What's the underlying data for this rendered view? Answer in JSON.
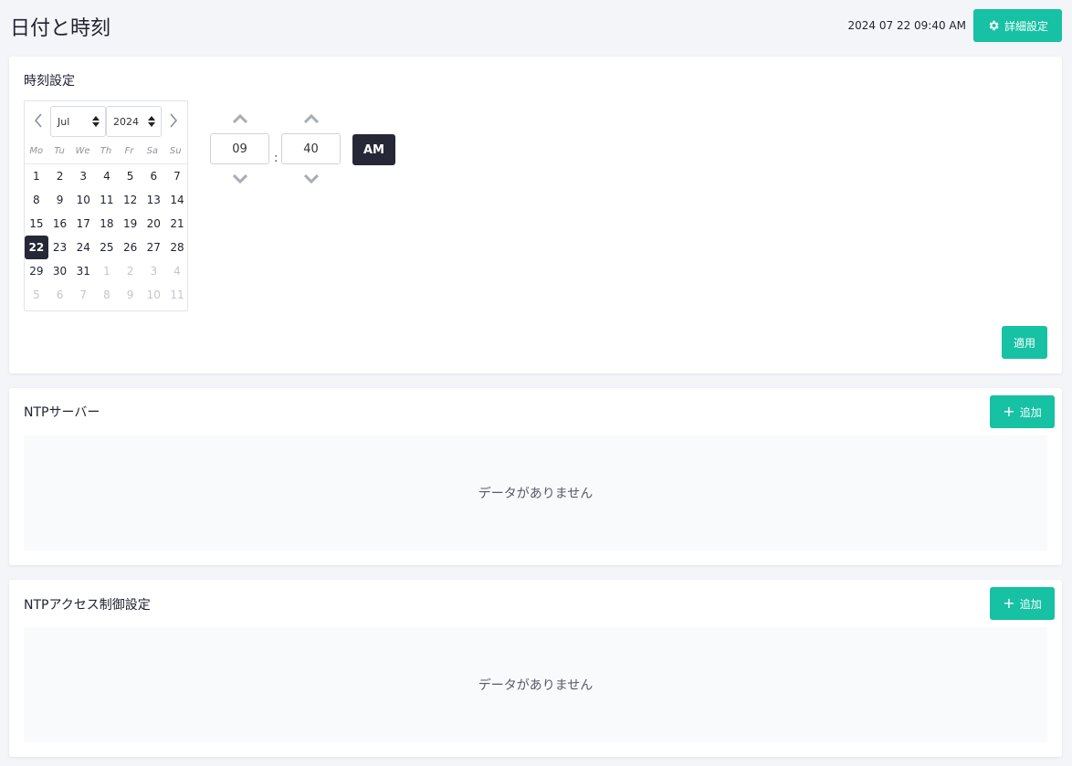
{
  "header": {
    "title": "日付と時刻",
    "datetime": "2024 07 22 09:40 AM",
    "settings_label": "詳細設定"
  },
  "time_settings": {
    "title": "時刻設定",
    "calendar": {
      "month": "Jul",
      "year": "2024",
      "weekdays": [
        "Mo",
        "Tu",
        "We",
        "Th",
        "Fr",
        "Sa",
        "Su"
      ],
      "days": [
        {
          "d": "1",
          "muted": false
        },
        {
          "d": "2",
          "muted": false
        },
        {
          "d": "3",
          "muted": false
        },
        {
          "d": "4",
          "muted": false
        },
        {
          "d": "5",
          "muted": false
        },
        {
          "d": "6",
          "muted": false
        },
        {
          "d": "7",
          "muted": false
        },
        {
          "d": "8",
          "muted": false
        },
        {
          "d": "9",
          "muted": false
        },
        {
          "d": "10",
          "muted": false
        },
        {
          "d": "11",
          "muted": false
        },
        {
          "d": "12",
          "muted": false
        },
        {
          "d": "13",
          "muted": false
        },
        {
          "d": "14",
          "muted": false
        },
        {
          "d": "15",
          "muted": false
        },
        {
          "d": "16",
          "muted": false
        },
        {
          "d": "17",
          "muted": false
        },
        {
          "d": "18",
          "muted": false
        },
        {
          "d": "19",
          "muted": false
        },
        {
          "d": "20",
          "muted": false
        },
        {
          "d": "21",
          "muted": false
        },
        {
          "d": "22",
          "muted": false,
          "selected": true
        },
        {
          "d": "23",
          "muted": false
        },
        {
          "d": "24",
          "muted": false
        },
        {
          "d": "25",
          "muted": false
        },
        {
          "d": "26",
          "muted": false
        },
        {
          "d": "27",
          "muted": false
        },
        {
          "d": "28",
          "muted": false
        },
        {
          "d": "29",
          "muted": false
        },
        {
          "d": "30",
          "muted": false
        },
        {
          "d": "31",
          "muted": false
        },
        {
          "d": "1",
          "muted": true
        },
        {
          "d": "2",
          "muted": true
        },
        {
          "d": "3",
          "muted": true
        },
        {
          "d": "4",
          "muted": true
        },
        {
          "d": "5",
          "muted": true
        },
        {
          "d": "6",
          "muted": true
        },
        {
          "d": "7",
          "muted": true
        },
        {
          "d": "8",
          "muted": true
        },
        {
          "d": "9",
          "muted": true
        },
        {
          "d": "10",
          "muted": true
        },
        {
          "d": "11",
          "muted": true
        }
      ]
    },
    "hour": "09",
    "minute": "40",
    "colon": ":",
    "meridiem": "AM",
    "apply_label": "適用"
  },
  "ntp_servers": {
    "title": "NTPサーバー",
    "add_label": "追加",
    "empty_text": "データがありません"
  },
  "ntp_access": {
    "title": "NTPアクセス制御設定",
    "add_label": "追加",
    "empty_text": "データがありません"
  },
  "colors": {
    "accent": "#16c1a4",
    "dark": "#262837",
    "background": "#f4f5f8"
  }
}
